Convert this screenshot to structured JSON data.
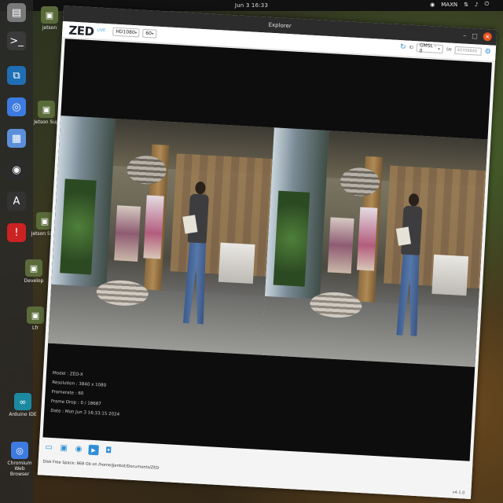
{
  "topbar": {
    "clock": "Jun 3  16:33"
  },
  "tray": {
    "user": "MAXN"
  },
  "dock": [
    {
      "name": "files-icon",
      "glyph": "▤",
      "color": "#7a7a7a"
    },
    {
      "name": "terminal-icon",
      "glyph": ">_",
      "color": "#3a3a3a"
    },
    {
      "name": "vscode-icon",
      "glyph": "⧉",
      "color": "#1f6fb5"
    },
    {
      "name": "chromium-icon",
      "glyph": "◎",
      "color": "#3d7be0"
    },
    {
      "name": "text-editor-icon",
      "glyph": "▦",
      "color": "#5c8fd9"
    },
    {
      "name": "obs-icon",
      "glyph": "◉",
      "color": "#2b2b2b"
    },
    {
      "name": "software-icon",
      "glyph": "A",
      "color": "#333333"
    },
    {
      "name": "help-icon",
      "glyph": "!",
      "color": "#c22"
    }
  ],
  "desktop_items": [
    {
      "label": "jetson"
    },
    {
      "label": "Jetson Sup"
    },
    {
      "label": "Jetson Si Fo"
    },
    {
      "label": "Develop"
    },
    {
      "label": "Lfr"
    },
    {
      "label": "Arduino IDE"
    },
    {
      "label": "Chromium Web Browser"
    }
  ],
  "window": {
    "title": "Explorer",
    "logo": "ZED",
    "live_label": "LIVE",
    "resolution_select": "HD1080",
    "fps_select": "60",
    "camera_select": "GMSL - 0",
    "sn_label": "SN",
    "sn_placeholder": "40709846",
    "info": {
      "model": "Model : ZED-X",
      "resolution": "Resolution : 3840 x 1080",
      "framerate": "Framerate : 60",
      "frame_drop": "Frame Drop : 0 / 18687",
      "date": "Date : Mon Jun 3 16:33:15 2024"
    },
    "disk_space": "Disk Free Space: 868 Gb  on  /home/jjenbot/Documents/ZED",
    "version": "v4.1.0"
  }
}
